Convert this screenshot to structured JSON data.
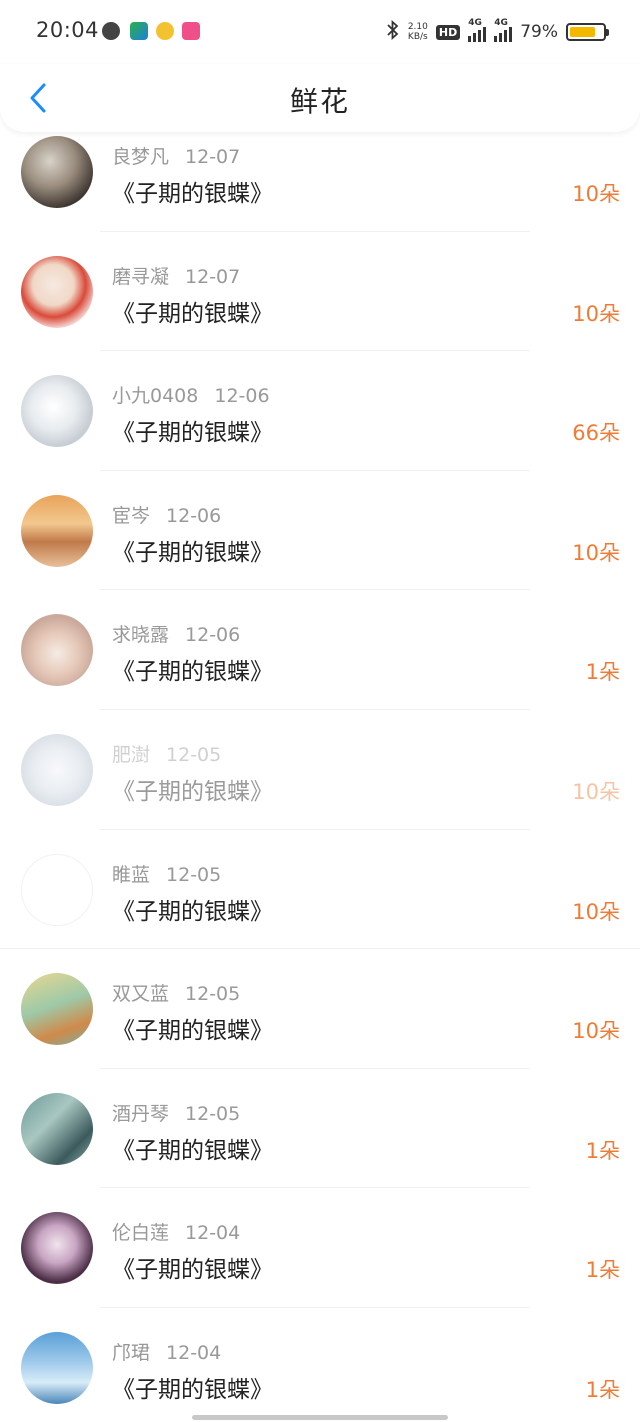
{
  "status_bar": {
    "time": "20:04",
    "net_speed_value": "2.10",
    "net_speed_unit": "KB/s",
    "hd_label": "HD",
    "signal_1_label": "4G",
    "signal_2_label": "4G",
    "battery_percent": "79%",
    "battery_level": 0.79,
    "battery_color": "#f5b800",
    "left_icons": [
      "globe-icon",
      "app-icon",
      "app-icon",
      "app-icon"
    ],
    "right_icons": [
      "bluetooth-icon",
      "hd-icon",
      "signal-icon",
      "signal-icon",
      "battery-icon"
    ]
  },
  "nav": {
    "back_icon": "chevron-left-icon",
    "title": "鲜花"
  },
  "accent_color": "#f07b34",
  "items": [
    {
      "user": "良梦凡",
      "date": "12-07",
      "book": "《子期的银蝶》",
      "count": "10朵"
    },
    {
      "user": "磨寻凝",
      "date": "12-07",
      "book": "《子期的银蝶》",
      "count": "10朵"
    },
    {
      "user": "小九0408",
      "date": "12-06",
      "book": "《子期的银蝶》",
      "count": "66朵"
    },
    {
      "user": "宦岑",
      "date": "12-06",
      "book": "《子期的银蝶》",
      "count": "10朵"
    },
    {
      "user": "求晓露",
      "date": "12-06",
      "book": "《子期的银蝶》",
      "count": "1朵"
    },
    {
      "user": "肥澍",
      "date": "12-05",
      "book": "《子期的银蝶》",
      "count": "10朵"
    },
    {
      "user": "睢蓝",
      "date": "12-05",
      "book": "《子期的银蝶》",
      "count": "10朵"
    },
    {
      "user": "双又蓝",
      "date": "12-05",
      "book": "《子期的银蝶》",
      "count": "10朵"
    },
    {
      "user": "酒丹琴",
      "date": "12-05",
      "book": "《子期的银蝶》",
      "count": "1朵"
    },
    {
      "user": "伦白莲",
      "date": "12-04",
      "book": "《子期的银蝶》",
      "count": "1朵"
    },
    {
      "user": "邝珺",
      "date": "12-04",
      "book": "《子期的银蝶》",
      "count": "1朵"
    }
  ]
}
